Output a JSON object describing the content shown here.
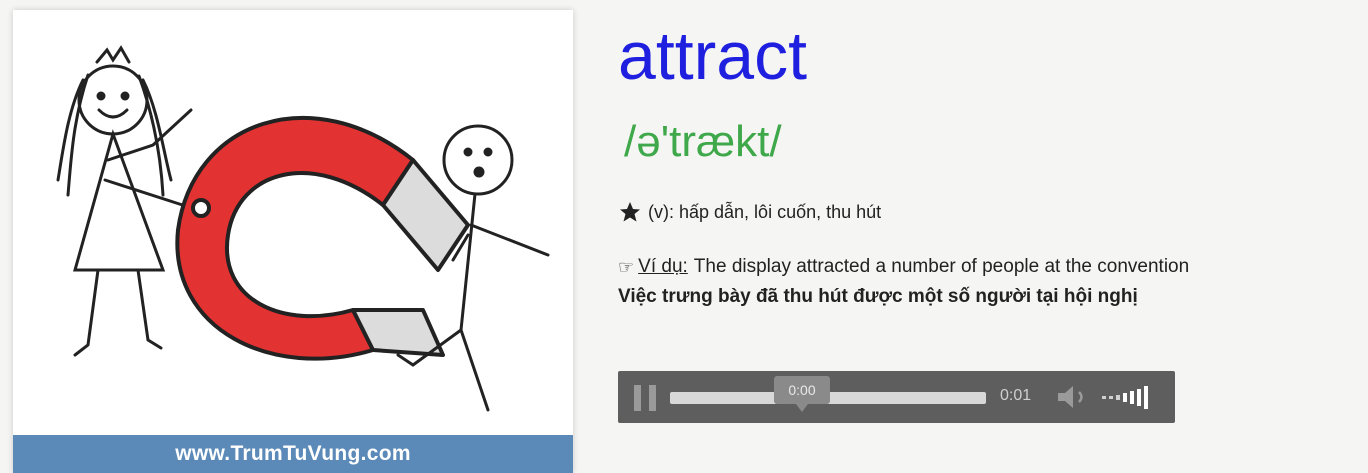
{
  "card": {
    "caption": "www.TrumTuVung.com"
  },
  "entry": {
    "word": "attract",
    "phonetic": "/ə'trækt/",
    "meaning": "(v): hấp dẫn, lôi cuốn, thu hút",
    "example_label": "Ví dụ:",
    "example_text": "The display attracted a number of people at the convention",
    "translation": "Việc trưng bày đã thu hút được một số người tại hội nghị"
  },
  "player": {
    "tooltip_time": "0:00",
    "duration": "0:01",
    "progress": 0.0
  },
  "colors": {
    "word": "#1f1fe0",
    "phonetic": "#3fa84a",
    "caption_bg": "#5b8ab8",
    "player_bg": "#5e5e5e",
    "magnet_red": "#e23232"
  },
  "icons": {
    "meaning": "star-icon",
    "example": "pointing-hand-icon",
    "play": "pause-icon",
    "sound": "speaker-icon",
    "volume": "volume-bars-icon"
  }
}
